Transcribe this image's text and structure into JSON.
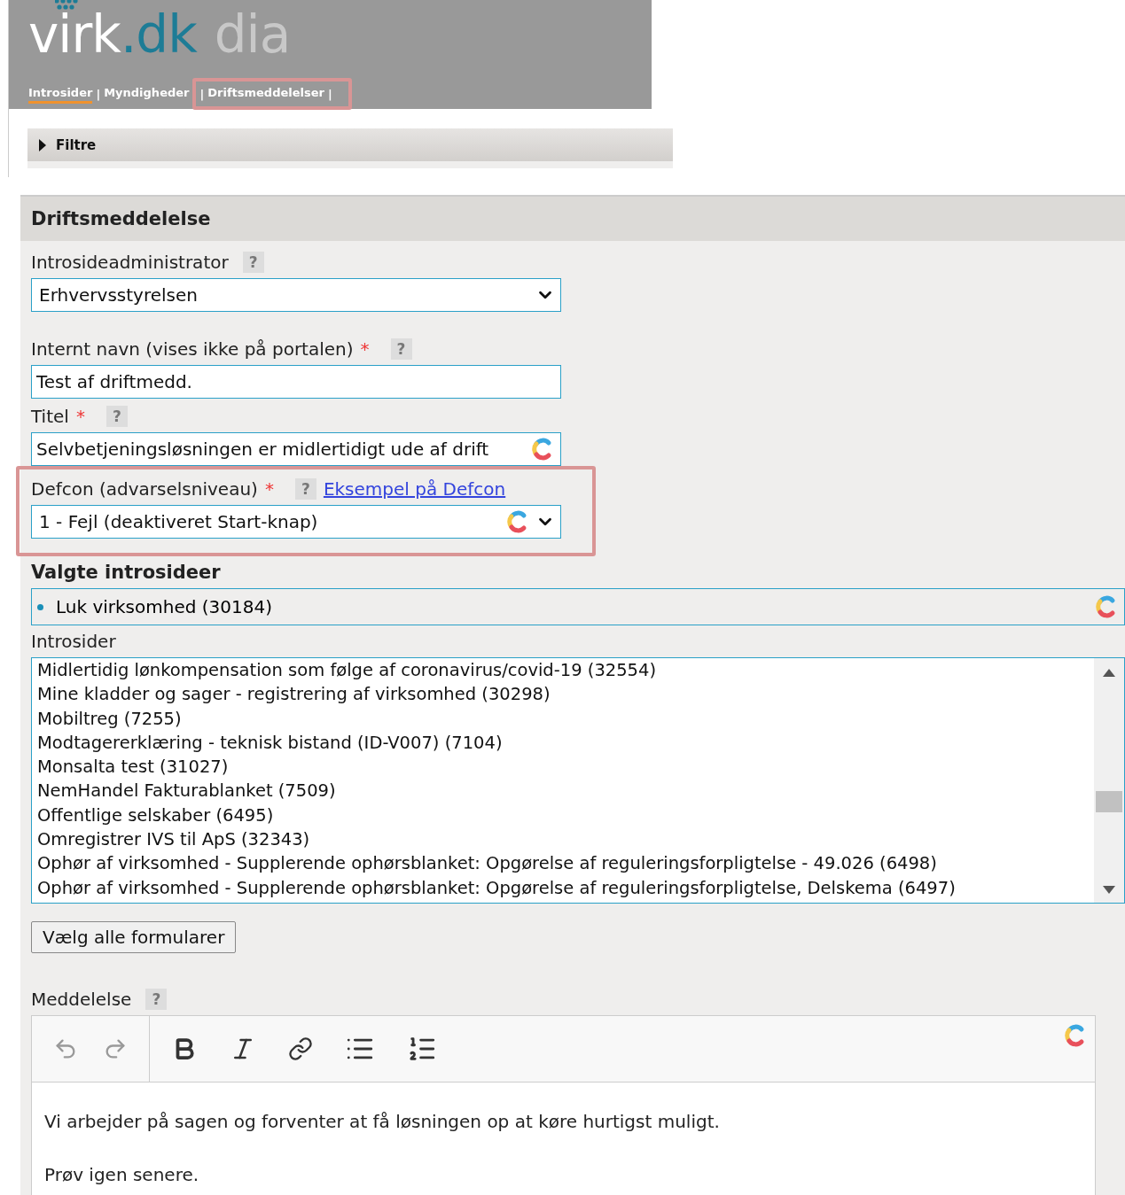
{
  "header": {
    "logo": {
      "part_1": "virk",
      "part_2": ".dk",
      "part_3": "dia"
    },
    "nav": [
      {
        "label": "Introsider",
        "selected": true
      },
      {
        "label": "Myndigheder",
        "selected": false
      },
      {
        "label": "Driftsmeddelelser",
        "selected": false,
        "highlighted": true
      }
    ],
    "separator": "|"
  },
  "filter": {
    "label": "Filtre",
    "expanded": false
  },
  "form": {
    "title": "Driftsmeddelelse",
    "admin": {
      "label": "Introsideadministrator",
      "help": "?",
      "value": "Erhvervsstyrelsen"
    },
    "internal_name": {
      "label": "Internt navn (vises ikke på portalen)",
      "required": true,
      "help": "?",
      "value": "Test af driftmedd."
    },
    "title_field": {
      "label": "Titel",
      "required": true,
      "help": "?",
      "value": "Selvbetjeningsløsningen er midlertidigt ude af drift"
    },
    "defcon": {
      "label": "Defcon (advarselsniveau)",
      "required": true,
      "help": "?",
      "link": "Eksempel på Defcon",
      "value": "1 - Fejl (deaktiveret Start-knap)",
      "highlighted": true
    },
    "required_mark": "*",
    "selected_heading": "Valgte introsideer",
    "selected_items": [
      "Luk virksomhed (30184)"
    ],
    "pages_label": "Introsider",
    "pages": [
      "Midlertidig lønkompensation som følge af coronavirus/covid-19 (32554)",
      "Mine kladder og sager - registrering af virksomhed (30298)",
      "Mobiltreg (7255)",
      "Modtagererklæring - teknisk bistand (ID-V007) (7104)",
      "Monsalta test (31027)",
      "NemHandel Fakturablanket (7509)",
      "Offentlige selskaber (6495)",
      "Omregistrer IVS til ApS (32343)",
      "Ophør af virksomhed - Supplerende ophørsblanket: Opgørelse af reguleringsforpligtelse - 49.026 (6498)",
      "Ophør af virksomhed - Supplerende ophørsblanket: Opgørelse af reguleringsforpligtelse, Delskema (6497)"
    ],
    "select_all": "Vælg alle formularer",
    "message": {
      "label": "Meddelelse",
      "help": "?",
      "paragraphs": [
        "Vi arbejder på sagen og forventer at få løsningen op at køre hurtigst muligt.",
        "Prøv igen senere."
      ]
    }
  }
}
